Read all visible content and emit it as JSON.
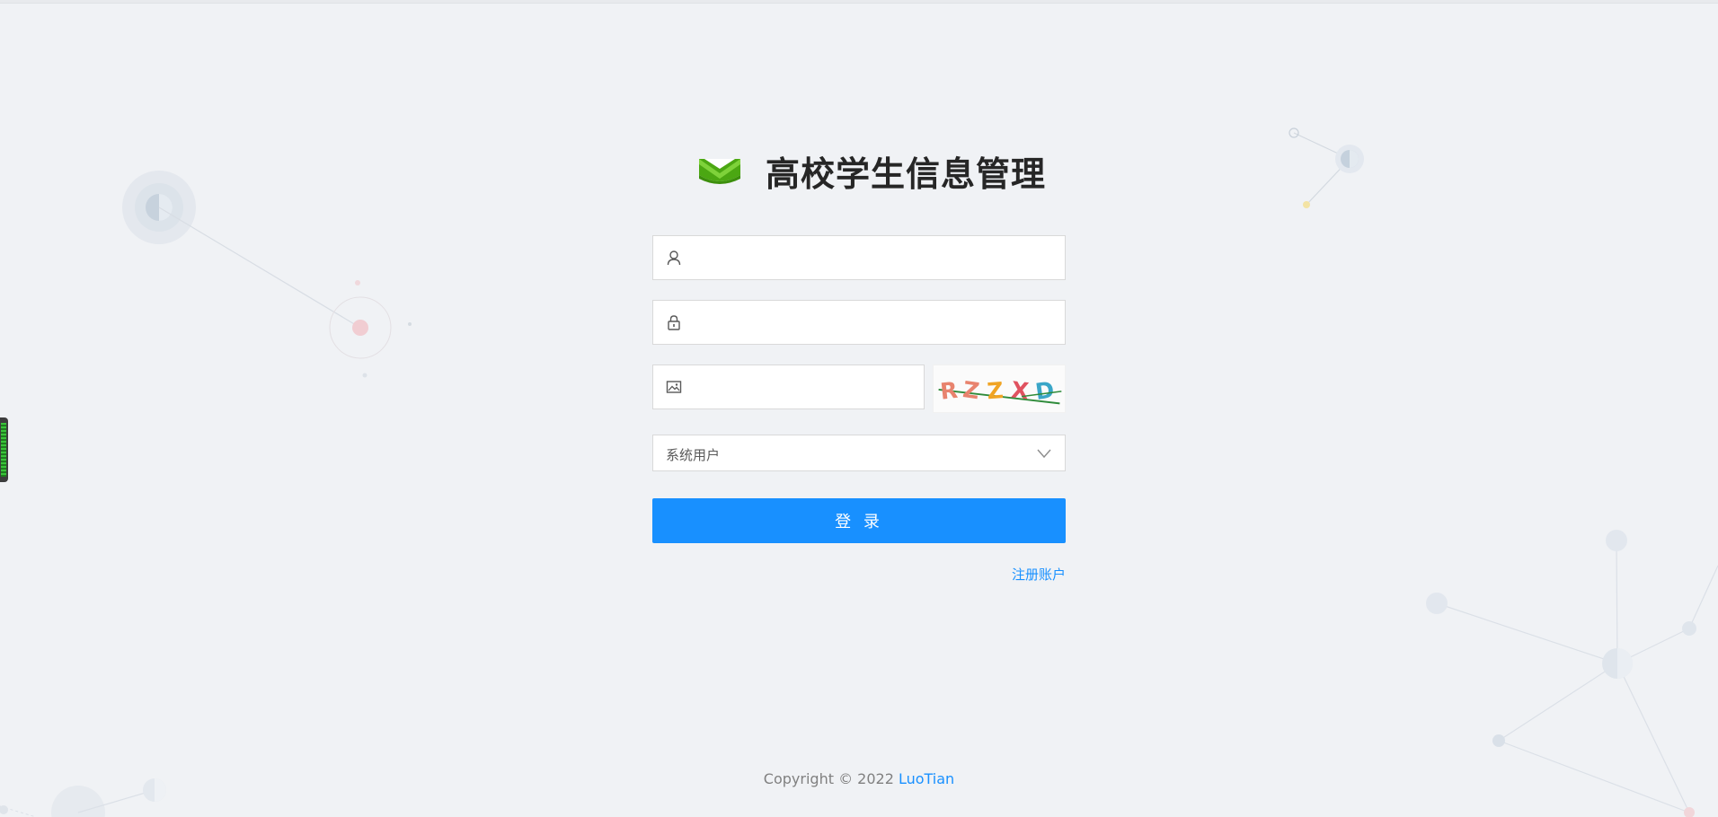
{
  "header": {
    "title": "高校学生信息管理",
    "logo_icon": "green-envelope-logo-icon"
  },
  "form": {
    "username": {
      "value": "",
      "placeholder": "",
      "icon": "user-icon"
    },
    "password": {
      "value": "",
      "placeholder": "",
      "icon": "lock-icon"
    },
    "captcha": {
      "value": "",
      "placeholder": "",
      "icon": "image-icon",
      "image_text": "RZZXD"
    },
    "user_type": {
      "selected": "系统用户",
      "icon": "chevron-down-icon"
    },
    "login_label": "登 录",
    "register_label": "注册账户"
  },
  "footer": {
    "copyright": "Copyright © 2022 ",
    "author": "LuoTian"
  },
  "colors": {
    "background": "#f0f2f5",
    "primary": "#1890ff",
    "logo_green": "#52b112"
  }
}
